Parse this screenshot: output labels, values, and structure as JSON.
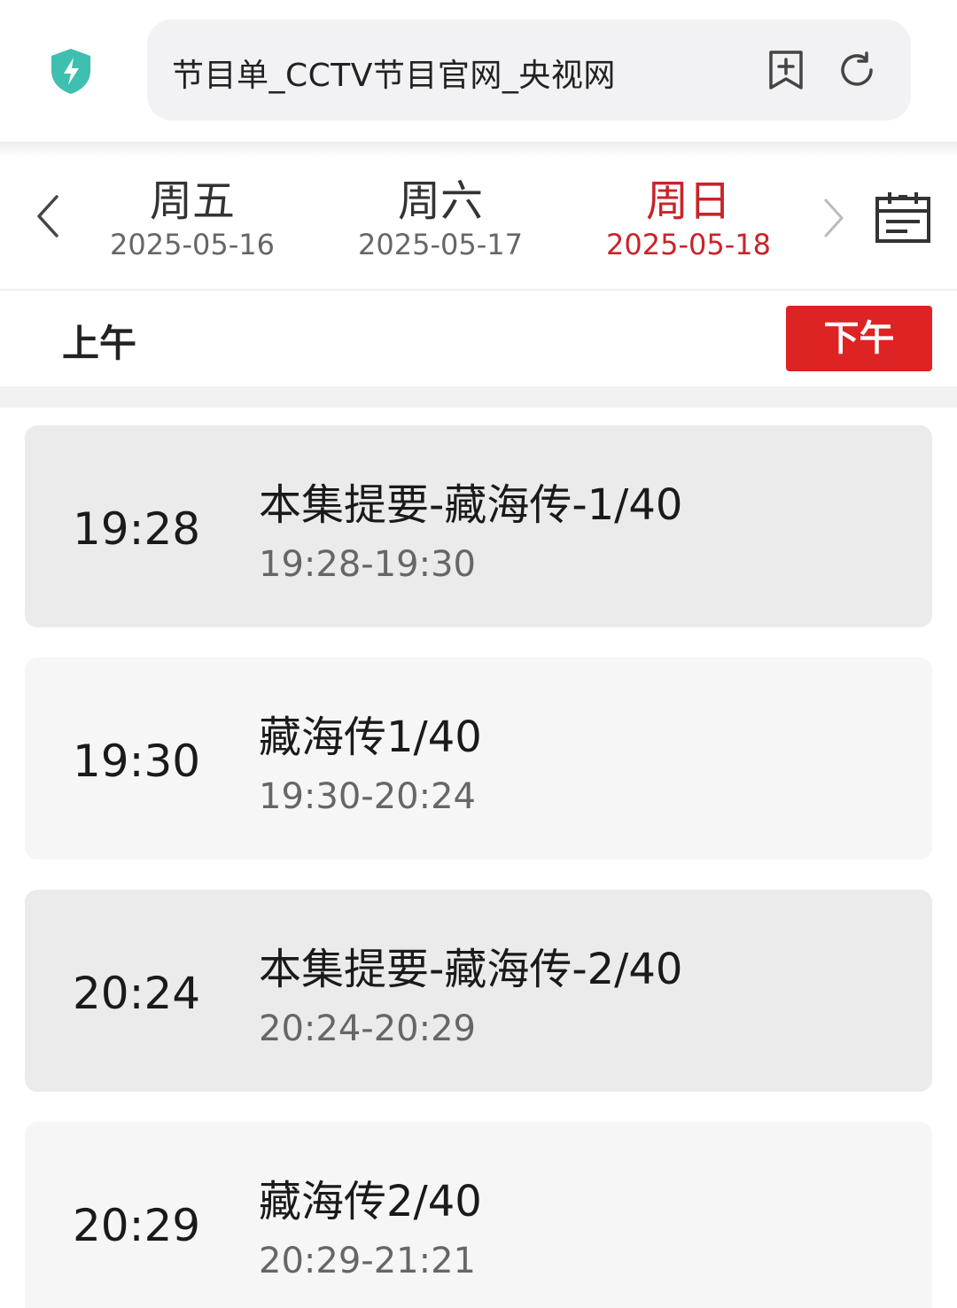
{
  "browser": {
    "title": "节目单_CCTV节目官网_央视网",
    "shield_icon": "shield-bolt-icon",
    "bookmark_icon": "add-bookmark-icon",
    "reload_icon": "reload-icon",
    "accent": "#3fbfb0"
  },
  "date_nav": {
    "prev_icon": "chevron-left-icon",
    "next_icon": "chevron-right-icon",
    "calendar_icon": "calendar-icon",
    "days": [
      {
        "weekday": "周五",
        "date": "2025-05-16",
        "active": false
      },
      {
        "weekday": "周六",
        "date": "2025-05-17",
        "active": false
      },
      {
        "weekday": "周日",
        "date": "2025-05-18",
        "active": true
      }
    ],
    "active_color": "#c8242a"
  },
  "period": {
    "am_label": "上午",
    "pm_label": "下午",
    "selected": "下午",
    "pm_color": "#dd2323"
  },
  "programs": [
    {
      "time": "19:28",
      "title": "本集提要-藏海传-1/40",
      "range": "19:28-19:30"
    },
    {
      "time": "19:30",
      "title": "藏海传1/40",
      "range": "19:30-20:24"
    },
    {
      "time": "20:24",
      "title": "本集提要-藏海传-2/40",
      "range": "20:24-20:29"
    },
    {
      "time": "20:29",
      "title": "藏海传2/40",
      "range": "20:29-21:21"
    }
  ]
}
